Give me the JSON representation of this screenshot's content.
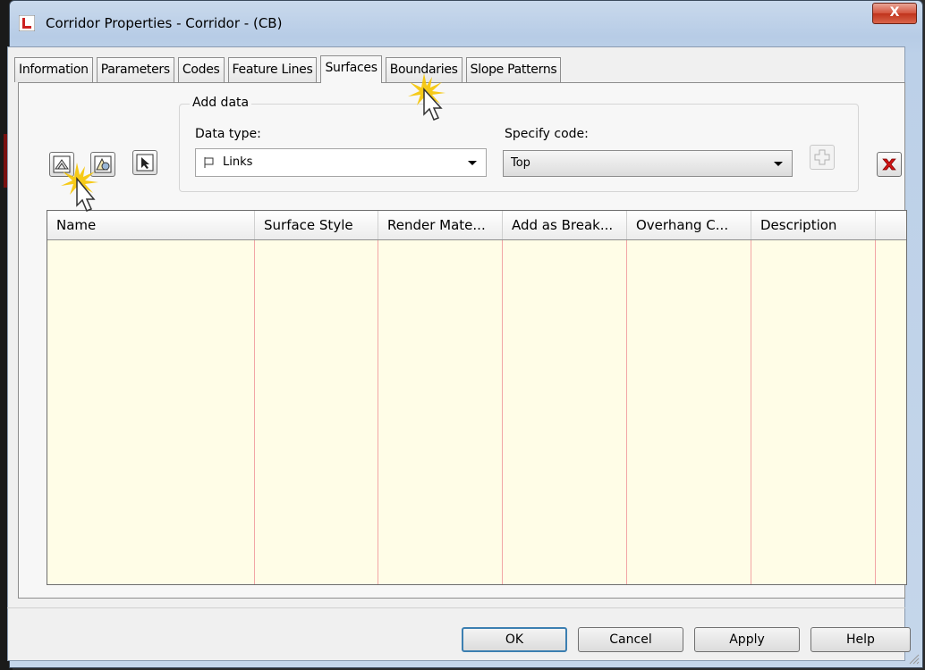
{
  "window": {
    "title": "Corridor Properties - Corridor - (CB)",
    "close_label": "X"
  },
  "tabs": [
    {
      "label": "Information"
    },
    {
      "label": "Parameters"
    },
    {
      "label": "Codes"
    },
    {
      "label": "Feature Lines"
    },
    {
      "label": "Surfaces",
      "active": true
    },
    {
      "label": "Boundaries"
    },
    {
      "label": "Slope Patterns"
    }
  ],
  "add_data": {
    "group_label": "Add data",
    "data_type_label": "Data type:",
    "data_type_value": "Links",
    "specify_code_label": "Specify code:",
    "specify_code_value": "Top"
  },
  "toolbar_icons": [
    "create-surface-icon",
    "surface-from-corridor-icon",
    "pick-icon"
  ],
  "table": {
    "columns": [
      "Name",
      "Surface Style",
      "Render Mate...",
      "Add as Break...",
      "Overhang C...",
      "Description"
    ],
    "rows": []
  },
  "buttons": {
    "ok": "OK",
    "cancel": "Cancel",
    "apply": "Apply",
    "help": "Help"
  },
  "colors": {
    "grid_bg": "#fffde7",
    "close_red": "#c0331c",
    "delete_red": "#cc0000",
    "default_btn_border": "#3c7fb1"
  }
}
